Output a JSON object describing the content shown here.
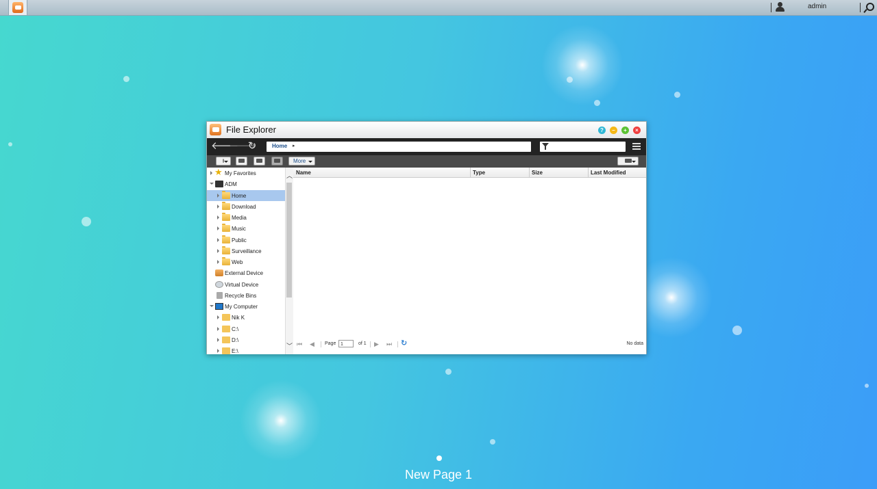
{
  "topbar": {
    "username": "admin"
  },
  "window": {
    "title": "File Explorer",
    "breadcrumb": "Home",
    "toolbar": {
      "more_label": "More"
    },
    "tree": [
      {
        "label": "My Favorites",
        "icon": "star-icon"
      },
      {
        "label": "ADM",
        "icon": "nas-icon"
      },
      {
        "label": "Home",
        "icon": "folder-icon",
        "selected": true
      },
      {
        "label": "Download",
        "icon": "folder-icon"
      },
      {
        "label": "Media",
        "icon": "folder-icon"
      },
      {
        "label": "Music",
        "icon": "folder-icon"
      },
      {
        "label": "Public",
        "icon": "folder-icon"
      },
      {
        "label": "Surveillance",
        "icon": "folder-icon"
      },
      {
        "label": "Web",
        "icon": "folder-icon"
      },
      {
        "label": "External Device",
        "icon": "external-device-icon"
      },
      {
        "label": "Virtual Device",
        "icon": "virtual-device-icon"
      },
      {
        "label": "Recycle Bins",
        "icon": "recycle-bin-icon"
      },
      {
        "label": "My Computer",
        "icon": "computer-icon"
      },
      {
        "label": "Nik K",
        "icon": "folder-icon"
      },
      {
        "label": "C:\\",
        "icon": "folder-icon"
      },
      {
        "label": "D:\\",
        "icon": "folder-icon"
      },
      {
        "label": "E:\\",
        "icon": "folder-icon"
      }
    ],
    "grid": {
      "columns": [
        "Name",
        "Type",
        "Size",
        "Last Modified"
      ]
    },
    "pager": {
      "page_label": "Page",
      "page_value": "1",
      "of_label": "of 1",
      "status": "No data"
    }
  },
  "desktop": {
    "page_name": "New Page 1"
  },
  "colors": {
    "selection": "#a8c8ee",
    "link_blue": "#1c4e8a",
    "help": "#2fb7d6",
    "minimize": "#f5b817",
    "maximize": "#5cc234",
    "close": "#ef3e3e"
  }
}
